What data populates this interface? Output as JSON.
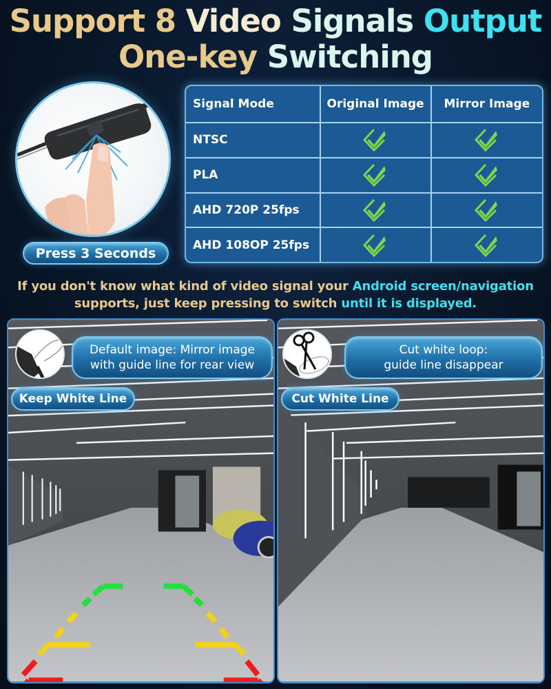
{
  "headline": {
    "line1": [
      {
        "text": "Support 8 ",
        "tone": "gold"
      },
      {
        "text": "Video ",
        "tone": "cream"
      },
      {
        "text": "Signals ",
        "tone": "mint"
      },
      {
        "text": "Output",
        "tone": "cyan"
      }
    ],
    "line2": [
      {
        "text": "One-key ",
        "tone": "gold"
      },
      {
        "text": "Switching",
        "tone": "mint"
      }
    ]
  },
  "press": {
    "label": "Press 3 Seconds"
  },
  "table": {
    "headers": [
      "Signal Mode",
      "Original Image",
      "Mirror Image"
    ],
    "rows": [
      {
        "mode": "NTSC",
        "original": true,
        "mirror": true
      },
      {
        "mode": "PLA",
        "original": true,
        "mirror": true
      },
      {
        "mode": "AHD 720P 25fps",
        "original": true,
        "mirror": true
      },
      {
        "mode": "AHD 108OP 25fps",
        "original": true,
        "mirror": true
      }
    ],
    "check_icon": "check-diamond-icon",
    "check_color": "#7fd64a"
  },
  "note": {
    "line1_a": "If you don't know what kind of video signal your ",
    "line1_b": "Android screen/navigation",
    "line2_a": "supports, just keep pressing to switch ",
    "line2_b": "until it is displayed."
  },
  "panels": {
    "left": {
      "caption": "Default image: Mirror image with guide line for rear view",
      "caption_line1": "Default image: Mirror image",
      "caption_line2": "with guide line for rear view",
      "label": "Keep White Line",
      "guide_lines": true,
      "guide_colors": [
        "#22e03a",
        "#f2d21a",
        "#ee1c1c"
      ]
    },
    "right": {
      "caption_line1": "Cut white loop:",
      "caption_line2": "guide line disappear",
      "label": "Cut White Line",
      "guide_lines": false
    }
  },
  "colors": {
    "background": "#081627",
    "table_fill": "#1b5a94",
    "pill_blue": "#1f6fa8",
    "gold": "#e8c98a",
    "cyan": "#3fe0f0"
  }
}
